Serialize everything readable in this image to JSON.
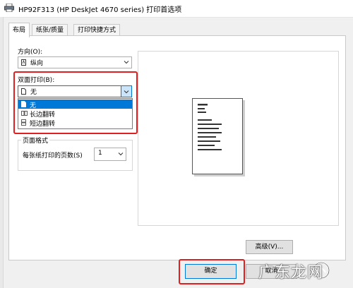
{
  "window": {
    "title": "HP92F313 (HP DeskJet 4670 series) 打印首选项"
  },
  "tabs": [
    {
      "label": "布局",
      "active": true
    },
    {
      "label": "纸张/质量",
      "active": false
    },
    {
      "label": "打印快捷方式",
      "active": false
    }
  ],
  "orientation": {
    "label": "方向(O):",
    "value": "纵向",
    "icon": "portrait-page-icon"
  },
  "duplex": {
    "label": "双面打印(B):",
    "value": "无",
    "options": [
      {
        "label": "无",
        "icon": "single-page-icon",
        "selected": true
      },
      {
        "label": "长边翻转",
        "icon": "long-edge-flip-icon",
        "selected": false
      },
      {
        "label": "短边翻转",
        "icon": "short-edge-flip-icon",
        "selected": false
      }
    ],
    "highlight_color": "#e02020"
  },
  "page_format": {
    "title": "页面格式",
    "pages_per_sheet_label": "每张纸打印的页数(S)",
    "pages_per_sheet_value": "1"
  },
  "buttons": {
    "advanced": "高级(V)...",
    "ok": "确定",
    "cancel": "取消"
  },
  "watermark": {
    "text": "广东龙网"
  },
  "colors": {
    "selection": "#0078d7",
    "highlight": "#e02020"
  }
}
